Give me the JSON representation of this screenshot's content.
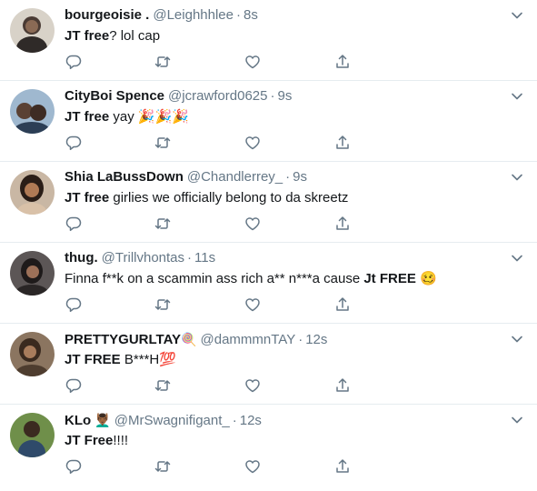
{
  "tweets": [
    {
      "name": "bourgeoisie .",
      "emoji": "",
      "handle": "@Leighhhlee",
      "time": "8s",
      "bold": "JT free",
      "rest": "? lol cap",
      "avatar_color": "#4a3b34"
    },
    {
      "name": "CityBoi Spence",
      "emoji": "",
      "handle": "@jcrawford0625",
      "time": "9s",
      "bold": "JT free",
      "rest": " yay 🎉🎉🎉",
      "avatar_color": "#6b8fb3"
    },
    {
      "name": "Shia LaBussDown",
      "emoji": "",
      "handle": "@Chandlerrey_",
      "time": "9s",
      "bold": "JT free",
      "rest": " girlies we officially belong to da skreetz",
      "avatar_color": "#8a5a3c"
    },
    {
      "name": "thug.",
      "emoji": "",
      "handle": "@Trillvhontas",
      "time": "11s",
      "bold": "",
      "rest": "Finna f**k on a scammin ass rich a** n***a cause ",
      "bold_end": "Jt FREE",
      "end_emoji": " 🥴",
      "avatar_color": "#3d3a3a"
    },
    {
      "name": "PRETTYGURLTAY",
      "emoji": "🍭",
      "handle": "@dammmnTAY",
      "time": "12s",
      "bold": "JT FREE",
      "rest": " B***H💯",
      "avatar_color": "#6e5a46"
    },
    {
      "name": "KLo",
      "emoji": "💆🏾‍♂️",
      "handle": "@MrSwagnifigant_",
      "time": "12s",
      "bold": "JT Free",
      "rest": "!!!!",
      "avatar_color": "#5a7a3a"
    }
  ],
  "icons": {
    "reply": "reply-icon",
    "retweet": "retweet-icon",
    "like": "like-icon",
    "share": "share-icon",
    "caret": "chevron-down-icon"
  },
  "colors": {
    "icon": "#657786",
    "border": "#e6ecf0",
    "name": "#14171a",
    "muted": "#657786"
  }
}
